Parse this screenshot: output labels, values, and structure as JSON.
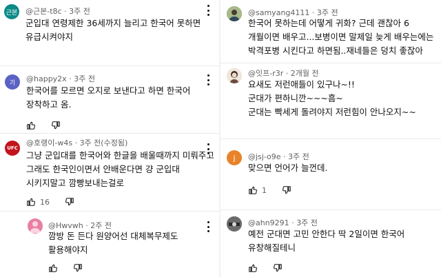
{
  "left_comments": [
    {
      "avatar": {
        "text": "근본",
        "color": "#0b8a87"
      },
      "handle": "@근본-t8c",
      "separator": "·",
      "time": "3주 전",
      "lines": [
        "군입대 연령제한 36세까지 늘리고 한국어 못하면",
        "유급시켜야지"
      ]
    },
    {
      "avatar": {
        "text": "기",
        "color": "#5a63c4"
      },
      "handle": "@happy2x",
      "separator": "·",
      "time": "3주 전",
      "lines": [
        "한국어를 모르면 오지로 보낸다고 하면 한국어",
        "장착하고 옴."
      ]
    },
    {
      "avatar": {
        "text": "UFC",
        "color": "#c1141b"
      },
      "handle": "@호랭이-w4s",
      "separator": "·",
      "time": "3주 전(수정됨)",
      "lines": [
        "그냥 군입대를 한국어와 한글을 배울때까지 미뤄주고",
        "그래도 한국인이면서 안배운다면 걍 군입대",
        "시키지말고 깜빵보내는걸로"
      ],
      "likes": "16"
    }
  ],
  "left_reply": {
    "avatar": {
      "text": "",
      "color": "#e87fa3"
    },
    "handle": "@Hwvwh",
    "separator": "·",
    "time": "2주 전",
    "lines": [
      "깜방 돈 든다 원양어선 대체복무제도",
      "활용해야지"
    ]
  },
  "right_comments": [
    {
      "avatar": {
        "text": "",
        "color": "#7c8d5a"
      },
      "handle": "@samyang4111",
      "separator": "·",
      "time": "3주 전",
      "lines": [
        "한국어 못하는데 어떻게 귀화? 근데 괜찮아 6",
        "개월이면 배우고...보병이면 말제일 늦게 배우는에는",
        "박격포병 시킨다고 하면됨..재네들은 덩치 좋잖아"
      ]
    },
    {
      "avatar": {
        "text": "",
        "color": "#d9c9b8"
      },
      "handle": "@잇프-r3r",
      "separator": "·",
      "time": "2개월 전",
      "lines": [
        "요새도 저런애들이 있구나~!!",
        "군대가 편하니깐~~~흠~",
        "군대는 빡세게 돌려야지 저런힘이 안나오지~~"
      ]
    },
    {
      "avatar": {
        "text": "j",
        "color": "#e8832a"
      },
      "handle": "@jsj-o9e",
      "separator": "·",
      "time": "3주 전",
      "lines": [
        "맞으면 언어가 늘껀데."
      ],
      "likes": "1"
    },
    {
      "avatar": {
        "text": "",
        "color": "#555555"
      },
      "handle": "@ahn9291",
      "separator": "·",
      "time": "3주 전",
      "lines": [
        "예전 군대면 고민 안한다 딱 2일이면 한국어",
        "유창해질테니"
      ]
    }
  ]
}
